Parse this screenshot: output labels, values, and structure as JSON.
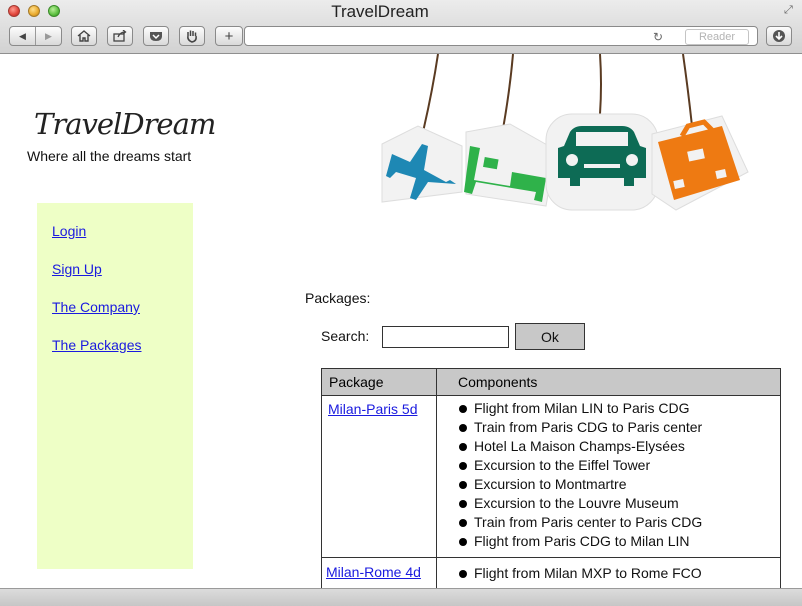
{
  "browser": {
    "title": "TravelDream",
    "reader_label": "Reader",
    "plus_label": "+"
  },
  "site": {
    "logo": "TravelDream",
    "tagline": "Where all the dreams start"
  },
  "sidebar": {
    "items": [
      {
        "label": "Login"
      },
      {
        "label": "Sign Up"
      },
      {
        "label": "The Company"
      },
      {
        "label": "The Packages"
      }
    ]
  },
  "main": {
    "packages_label": "Packages:",
    "search_label": "Search:",
    "search_value": "",
    "ok_label": "Ok",
    "table": {
      "headers": [
        "Package",
        "Components"
      ],
      "rows": [
        {
          "package": "Milan-Paris 5d",
          "components": [
            "Flight from Milan LIN to Paris CDG",
            "Train from Paris CDG to Paris center",
            "Hotel La Maison Champs-Elysées",
            "Excursion to the Eiffel Tower",
            "Excursion to Montmartre",
            "Excursion to the Louvre Museum",
            "Train from Paris center to Paris CDG",
            "Flight from Paris CDG to Milan LIN"
          ]
        },
        {
          "package": "Milan-Rome 4d",
          "components": [
            "Flight from Milan MXP to Rome FCO"
          ]
        }
      ]
    }
  },
  "colors": {
    "sidebar_bg": "#eeffc6",
    "link": "#1a1adf",
    "table_header_bg": "#c8c8c8",
    "tag_plane": "#1e88b4",
    "tag_bed": "#2fb24a",
    "tag_car": "#0d6b55",
    "tag_luggage": "#ee7a12"
  }
}
